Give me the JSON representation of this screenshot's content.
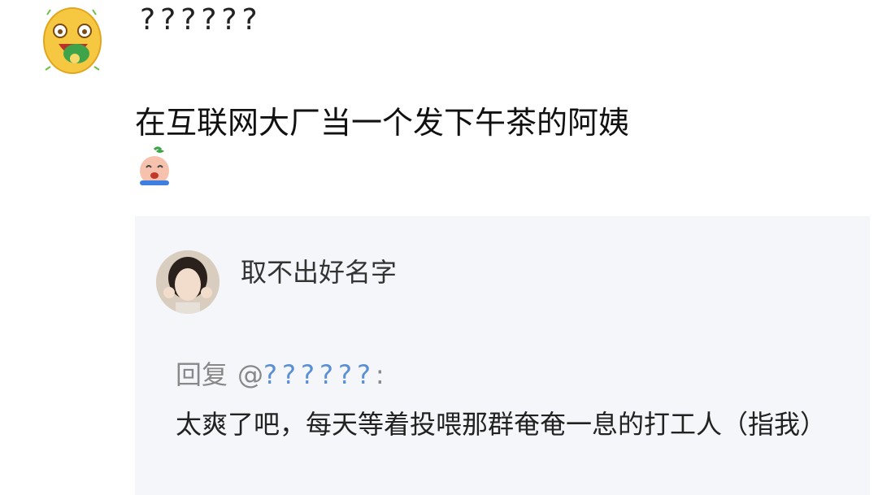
{
  "comment": {
    "username": "??????",
    "avatar_icon": "laughing-emoji-avatar-icon",
    "body": "在互联网大厂当一个发下午茶的阿姨",
    "emoji_icon": "crying-face-icon"
  },
  "reply": {
    "username": "取不出好名字",
    "avatar_icon": "user-photo-avatar",
    "prefix": "回复",
    "at_symbol": "@",
    "mention": "??????",
    "colon": ":",
    "text": "太爽了吧，每天等着投喂那群奄奄一息的打工人（指我）"
  },
  "colors": {
    "mention": "#5a8fd6",
    "reply_bg": "#f4f6f9"
  }
}
